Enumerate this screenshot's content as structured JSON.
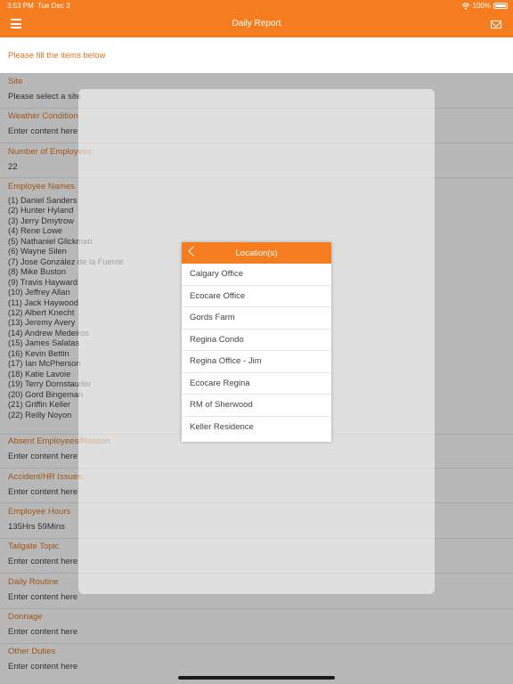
{
  "status_bar": {
    "time": "3:53 PM",
    "date": "Tue Dec 3",
    "battery": "100%"
  },
  "nav": {
    "title": "Daily Report"
  },
  "form": {
    "intro": "Please fill the items below",
    "site": {
      "label": "Site",
      "value": "Please select a site"
    },
    "weather": {
      "label": "Weather Condition",
      "value": "Enter content here"
    },
    "employees_count": {
      "label": "Number of Employees",
      "value": "22"
    },
    "employee_names": {
      "label": "Employee Names",
      "names": [
        "(1) Daniel  Sanders",
        "(2) Hunter  Hyland",
        "(3) Jerry Dmytrow",
        "(4) Rene Lowe",
        "(5) Nathaniel Glickman",
        "(6) Wayne Silen",
        "(7) Jose González de la Fuente",
        "(8) Mike Buston",
        "(9) Travis Hayward",
        "(10) Jeffrey Allan",
        "(11) Jack  Haywood",
        "(12) Albert  Knecht",
        "(13) Jeremy Avery",
        "(14) Andrew Medeiros",
        "(15) James Salatas",
        "(16) Kevin Bettin",
        "(17) Ian McPherson",
        "(18) Katie Lavoie",
        "(19) Terry Dornstauder",
        "(20) Gord Bingeman",
        "(21) Griffin Keller",
        "(22) Reilly Noyon"
      ]
    },
    "absent": {
      "label": "Absent Employees/Reason",
      "value": "Enter content here"
    },
    "accident": {
      "label": "Accident/HR Issues:",
      "value": "Enter content here"
    },
    "hours": {
      "label": "Employee Hours",
      "value": "135Hrs 59Mins"
    },
    "tailgate": {
      "label": "Tailgate Topic",
      "value": "Enter content here"
    },
    "routine": {
      "label": "Daily Routine",
      "value": "Enter content here"
    },
    "donnage": {
      "label": "Donnage",
      "value": "Enter content here"
    },
    "other": {
      "label": "Other Duties",
      "value": "Enter content here"
    }
  },
  "location_popup": {
    "title": "Location(s)",
    "items": [
      "Calgary Office",
      "Ecocare Office",
      "Gords Farm",
      "Regina Condo",
      "Regina Office - Jim",
      "Ecocare Regina",
      "RM of Sherwood",
      "Keller Residence"
    ]
  },
  "colors": {
    "accent": "#f57c1f",
    "label": "#e0741e"
  },
  "icons": {
    "menu": "hamburger-icon",
    "mail": "mail-icon",
    "wifi": "wifi-icon",
    "back": "chevron-left-icon"
  }
}
